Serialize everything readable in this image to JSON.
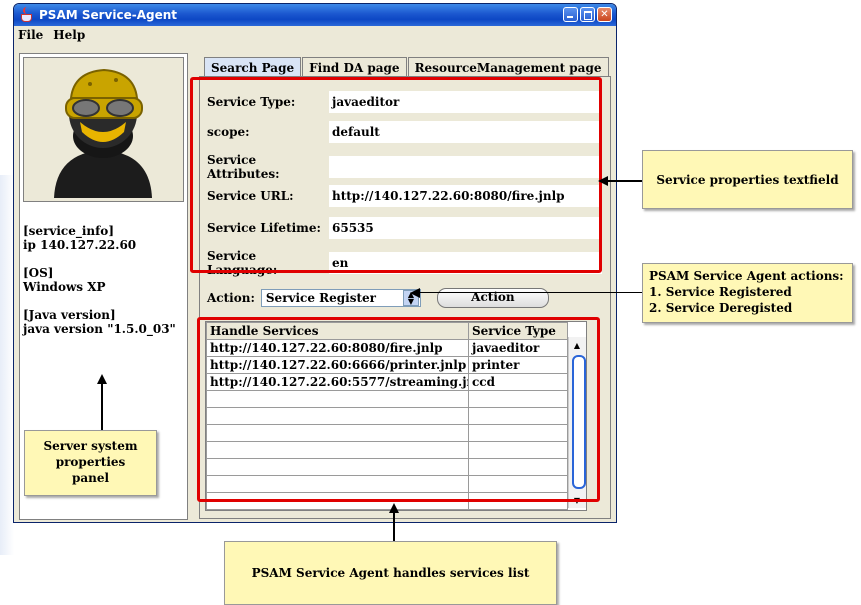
{
  "window": {
    "title": "PSAM Service-Agent"
  },
  "menu": [
    "File",
    "Help"
  ],
  "system_info": {
    "lines": [
      "[service_info]",
      "ip 140.127.22.60",
      "",
      "[OS]",
      "Windows XP",
      "",
      "[Java version]",
      "java version \"1.5.0_03\""
    ]
  },
  "tabs": [
    "Search Page",
    "Find DA page",
    "ResourceManagement page"
  ],
  "properties": [
    {
      "label": "Service Type:",
      "value": "javaeditor"
    },
    {
      "label": "scope:",
      "value": "default"
    },
    {
      "label": "Service Attributes:",
      "value": ""
    },
    {
      "label": "Service URL:",
      "value": "http://140.127.22.60:8080/fire.jnlp"
    },
    {
      "label": "Service Lifetime:",
      "value": "65535"
    },
    {
      "label": "Service Language:",
      "value": "en"
    }
  ],
  "action": {
    "label": "Action:",
    "selected": "Service Register",
    "button": "Action"
  },
  "services_table": {
    "columns": [
      "Handle Services",
      "Service Type"
    ],
    "rows": [
      [
        "http://140.127.22.60:8080/fire.jnlp",
        "javaeditor"
      ],
      [
        "http://140.127.22.60:6666/printer.jnlp",
        "printer"
      ],
      [
        "http://140.127.22.60:5577/streaming.jnlp",
        "ccd"
      ]
    ]
  },
  "callouts": {
    "properties": "Service properties textfield",
    "actions": [
      "PSAM Service Agent actions:",
      "1. Service Registered",
      "2. Service Deregisted"
    ],
    "system": [
      "Server system",
      "properties",
      "panel"
    ],
    "services": "PSAM Service Agent handles services list"
  },
  "colors": {
    "highlight": "#e00000",
    "callout_fill": "#fff8b6",
    "titlebar": "#1b57cf"
  }
}
